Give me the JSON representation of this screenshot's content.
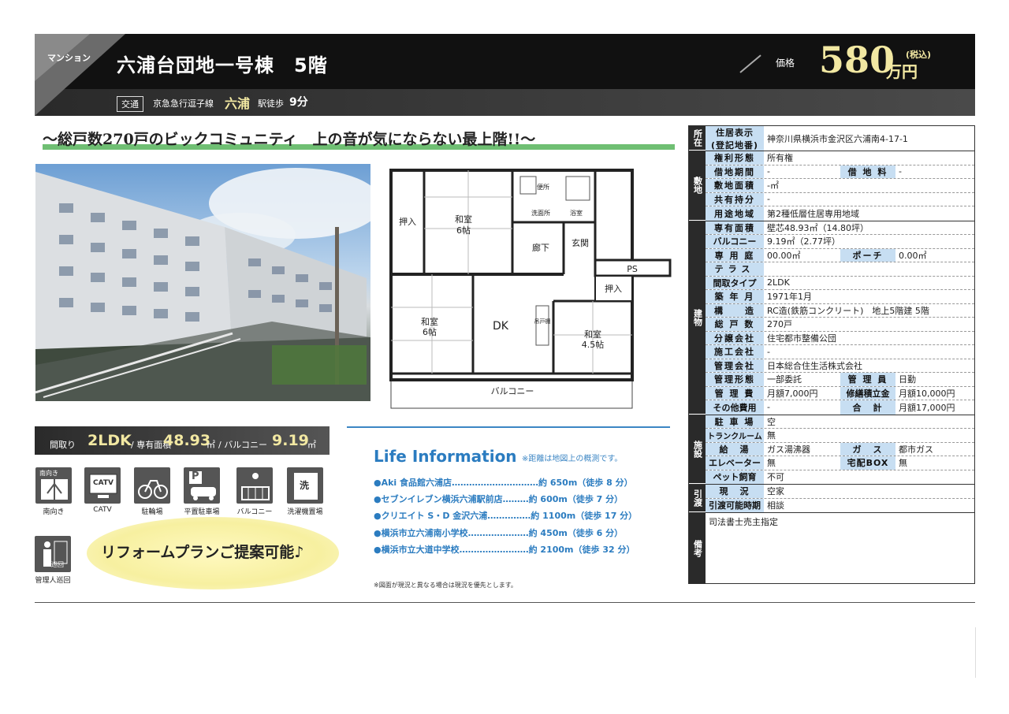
{
  "header": {
    "property_type": "マンション",
    "title": "六浦台団地一号棟　5階",
    "price_label": "価格",
    "price": "580",
    "price_unit": "万円",
    "price_tax": "(税込)",
    "traffic_tag": "交通",
    "traffic_line": "京急急行逗子線",
    "traffic_station": "六浦",
    "traffic_walk": "駅徒歩",
    "traffic_minutes": "9分"
  },
  "catch_copy": "～総戸数270戸のビックコミュニティ　上の音が気にならない最上階!!～",
  "floor_plan": {
    "rooms": {
      "oshiire1": "押入",
      "washitsu6a": "和室",
      "washitsu6a_size": "6帖",
      "toilet": "便所",
      "senmen": "洗面所",
      "yokushitsu": "浴室",
      "rouka": "廊下",
      "genkan": "玄関",
      "ps": "PS",
      "oshiire2": "押入",
      "washitsu6b": "和室",
      "washitsu6b_size": "6帖",
      "dk": "DK",
      "tsuri": "吊戸棚",
      "washitsu45": "和室",
      "washitsu45_size": "4.5帖",
      "balcony": "バルコニー"
    }
  },
  "spec_band": {
    "madori_label": "間取り",
    "madori": "2LDK",
    "area_label": "/ 専有面積",
    "area": "48.93",
    "area_unit": "㎡",
    "balcony_label": "/ バルコニー",
    "balcony": "9.19",
    "balcony_unit": "㎡"
  },
  "features": [
    {
      "label": "南向き",
      "badge": "南向き"
    },
    {
      "label": "CATV",
      "badge": "CATV"
    },
    {
      "label": "駐輪場",
      "badge": ""
    },
    {
      "label": "平置駐車場",
      "badge": "P"
    },
    {
      "label": "バルコニー",
      "badge": ""
    },
    {
      "label": "洗濯機置場",
      "badge": "洗"
    },
    {
      "label": "管理人巡回",
      "badge": "巡回"
    }
  ],
  "reform": "リフォームプランご提案可能♪",
  "life": {
    "title": "Life Information",
    "note": "※距離は地図上の概測です。",
    "items": [
      "●Aki 食品館六浦店…………………………約 650m（徒歩 8 分）",
      "●セブンイレブン横浜六浦駅前店………約 600m（徒歩 7 分）",
      "●クリエイト S・D 金沢六浦……………約 1100m（徒歩 17 分）",
      "●横浜市立六浦南小学校…………………約 450m（徒歩 6 分）",
      "●横浜市立大道中学校……………………約 2100m（徒歩 32 分）"
    ],
    "fine_note": "※図面が現況と異なる場合は現況を優先とします。"
  },
  "table": {
    "cat_location": "所在",
    "cat_land": "敷地",
    "cat_building": "建物",
    "cat_facility": "施設",
    "cat_handover": "引渡",
    "cat_remarks": "備考",
    "address_label": "住居表示\n(登記地番)",
    "address_l1": "住居表示",
    "address_l2": "(登記地番)",
    "address": "神奈川県横浜市金沢区六浦南4-17-1",
    "rows_land": [
      {
        "l": "権利形態",
        "v": "所有権"
      },
      {
        "l": "借地期間",
        "v": "-",
        "l2": "借 地 料",
        "v2": "-"
      },
      {
        "l": "敷地面積",
        "v": "-㎡"
      },
      {
        "l": "共有持分",
        "v": "-"
      },
      {
        "l": "用途地域",
        "v": "第2種低層住居専用地域"
      }
    ],
    "rows_building": [
      {
        "l": "専有面積",
        "v": "壁芯48.93㎡（14.80坪）"
      },
      {
        "l": "バルコニー",
        "v": "9.19㎡（2.77坪）"
      },
      {
        "l": "専 用 庭",
        "v": "00.00㎡",
        "l2": "ポーチ",
        "v2": "0.00㎡"
      },
      {
        "l": "テラス",
        "v": ""
      },
      {
        "l": "間取タイプ",
        "v": "2LDK"
      },
      {
        "l": "築 年 月",
        "v": "1971年1月"
      },
      {
        "l": "構　　造",
        "v": "RC造(鉄筋コンクリート)　地上5階建 5階"
      },
      {
        "l": "総 戸 数",
        "v": "270戸"
      },
      {
        "l": "分譲会社",
        "v": "住宅都市整備公団"
      },
      {
        "l": "施工会社",
        "v": "-"
      },
      {
        "l": "管理会社",
        "v": "日本総合住生活株式会社"
      },
      {
        "l": "管理形態",
        "v": "一部委託",
        "l2": "管 理 員",
        "v2": "日勤"
      },
      {
        "l": "管 理 費",
        "v": "月額7,000円",
        "l2": "修繕積立金",
        "v2": "月額10,000円"
      },
      {
        "l": "その他費用",
        "v": "-",
        "l2": "合　計",
        "v2": "月額17,000円"
      }
    ],
    "rows_facility": [
      {
        "l": "駐 車 場",
        "v": "空"
      },
      {
        "l": "トランクルーム",
        "v": "無"
      },
      {
        "l": "給　湯",
        "v": "ガス湯沸器",
        "l2": "ガ　ス",
        "v2": "都市ガス"
      },
      {
        "l": "エレベーター",
        "v": "無",
        "l2": "宅配BOX",
        "v2": "無"
      },
      {
        "l": "ペット飼育",
        "v": "不可"
      }
    ],
    "rows_handover": [
      {
        "l": "現　況",
        "v": "空家"
      },
      {
        "l": "引渡可能時期",
        "v": "相談"
      }
    ],
    "remarks": "司法書士売主指定"
  }
}
